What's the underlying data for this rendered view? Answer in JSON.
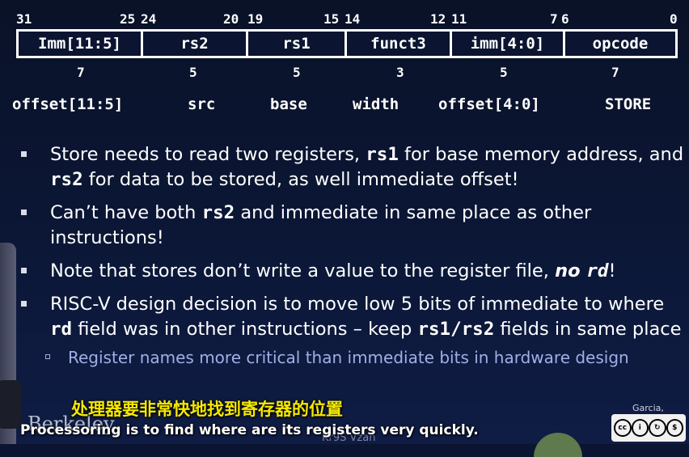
{
  "bit_numbers": [
    "31",
    "25",
    "24",
    "20",
    "19",
    "15",
    "14",
    "12",
    "11",
    "7",
    "6",
    "0"
  ],
  "fields": [
    {
      "label": "Imm[11:5]",
      "width": "7",
      "meaning": "offset[11:5]"
    },
    {
      "label": "rs2",
      "width": "5",
      "meaning": "src"
    },
    {
      "label": "rs1",
      "width": "5",
      "meaning": "base"
    },
    {
      "label": "funct3",
      "width": "3",
      "meaning": "width"
    },
    {
      "label": "imm[4:0]",
      "width": "5",
      "meaning": "offset[4:0]"
    },
    {
      "label": "opcode",
      "width": "7",
      "meaning": "STORE"
    }
  ],
  "bullets": {
    "b1": {
      "t1": "Store needs to read two registers, ",
      "c1": "rs1",
      "t2": " for base memory address, and ",
      "c2": "rs2",
      "t3": " for data to be stored, as well immediate offset!"
    },
    "b2": {
      "t1": "Can’t have both ",
      "c1": "rs2",
      "t2": " and immediate in same place as other instructions!"
    },
    "b3": {
      "t1": "Note that stores don’t write a value to the register file, ",
      "em": "no ",
      "c1": "rd",
      "t2": "!"
    },
    "b4": {
      "t1": "RISC-V design decision is to move low 5 bits of immediate to where ",
      "c1": "rd",
      "t2": " field was in other instructions – keep ",
      "c2": "rs1/rs2",
      "t3": " fields in same place"
    },
    "sub": "Register names more critical than immediate bits in hardware design"
  },
  "subtitles": {
    "zh": "处理器要非常快地找到寄存器的位置",
    "en": "Processoring is to find where are its registers very quickly."
  },
  "branding": {
    "logo": "Berkeley",
    "watermark": "Kr9S Vzan",
    "author": "Garcia, Nikolić",
    "cc_icons": [
      "cc-icon",
      "by-icon",
      "sa-icon",
      "nc-icon"
    ]
  }
}
